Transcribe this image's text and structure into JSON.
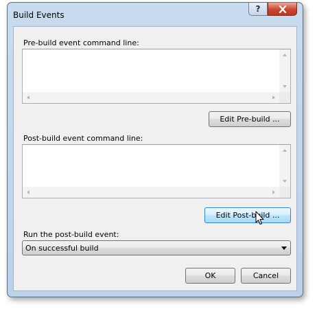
{
  "window": {
    "title": "Build Events",
    "help_label": "?"
  },
  "prebuild": {
    "label": "Pre-build event command line:",
    "value": "",
    "edit_button": "Edit Pre-build ..."
  },
  "postbuild": {
    "label": "Post-build event command line:",
    "value": "",
    "edit_button": "Edit Post-build ..."
  },
  "run_event": {
    "label": "Run the post-build event:",
    "selected": "On successful build"
  },
  "footer": {
    "ok_label": "OK",
    "cancel_label": "Cancel"
  },
  "icons": {
    "close": "close-icon",
    "help": "help-icon",
    "cursor": "pointer-cursor-icon"
  },
  "colors": {
    "close_button": "#c8462f",
    "hover_button": "#bee6fd",
    "frame": "#bcd2ea"
  }
}
